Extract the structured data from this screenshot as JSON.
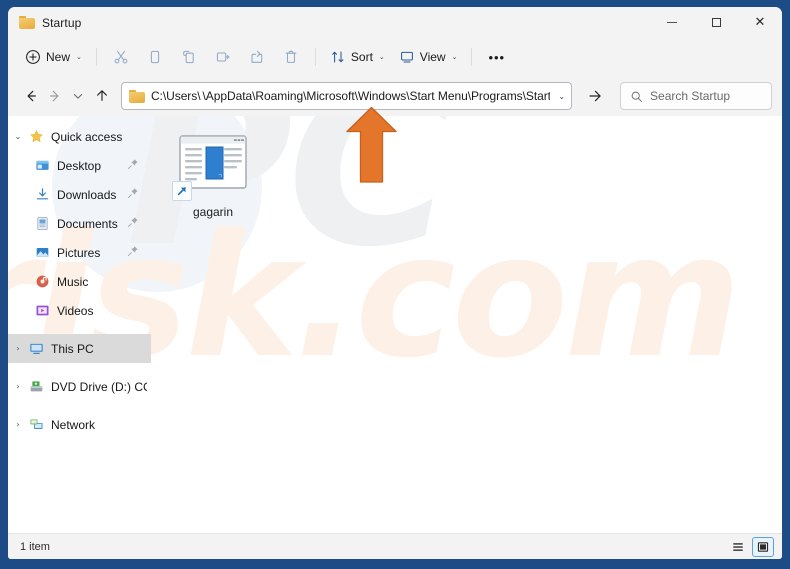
{
  "window": {
    "title": "Startup",
    "title_icon": "folder-icon",
    "controls": {
      "minimize": "–",
      "maximize": "□",
      "close": "×"
    }
  },
  "toolbar": {
    "new_label": "New",
    "new_icon": "plus-circle-icon",
    "cut_icon": "scissors-icon",
    "copy_icon": "copy-icon",
    "paste_icon": "paste-icon",
    "rename_icon": "rename-icon",
    "share_icon": "share-icon",
    "delete_icon": "trash-icon",
    "sort_label": "Sort",
    "sort_icon": "sort-arrows-icon",
    "view_label": "View",
    "view_icon": "monitor-icon",
    "more_label": "•••",
    "chevron": "⌄"
  },
  "navigation": {
    "back_icon": "arrow-left-icon",
    "forward_icon": "arrow-right-icon",
    "recent_icon": "chevron-down-icon",
    "up_icon": "arrow-up-icon",
    "go_icon": "arrow-right-icon"
  },
  "address": {
    "folder_icon": "folder-icon",
    "path_prefix": "C:\\Users\\",
    "path_suffix": "\\AppData\\Roaming\\Microsoft\\Windows\\Start Menu\\Programs\\Startup",
    "redacted_username": "",
    "dropdown_chevron": "⌄"
  },
  "search": {
    "icon": "search-icon",
    "placeholder": "Search Startup",
    "value": ""
  },
  "sidebar": {
    "groups": [
      {
        "label": "Quick access",
        "icon": "star-icon",
        "expander": "⌄",
        "expanded": true,
        "selected": false,
        "items": [
          {
            "label": "Desktop",
            "icon": "desktop-icon",
            "pinned": true,
            "selected": false
          },
          {
            "label": "Downloads",
            "icon": "download-icon",
            "pinned": true,
            "selected": false
          },
          {
            "label": "Documents",
            "icon": "documents-icon",
            "pinned": true,
            "selected": false
          },
          {
            "label": "Pictures",
            "icon": "pictures-icon",
            "pinned": true,
            "selected": false
          },
          {
            "label": "Music",
            "icon": "music-icon",
            "pinned": false,
            "selected": false
          },
          {
            "label": "Videos",
            "icon": "videos-icon",
            "pinned": false,
            "selected": false
          }
        ]
      }
    ],
    "roots": [
      {
        "label": "This PC",
        "icon": "this-pc-icon",
        "expander": "›",
        "selected": true
      },
      {
        "label": "DVD Drive (D:) CCCC",
        "icon": "dvd-drive-icon",
        "expander": "›",
        "selected": false
      },
      {
        "label": "Network",
        "icon": "network-icon",
        "expander": "›",
        "selected": false
      }
    ]
  },
  "content": {
    "files": [
      {
        "name": "gagarin",
        "icon": "application-window-icon",
        "shortcut_overlay": "shortcut-arrow-icon",
        "selected": false
      }
    ]
  },
  "statusbar": {
    "item_count": "1 item",
    "details_view_icon": "details-view-icon",
    "large_icons_view_icon": "large-icons-view-icon",
    "active_view": "large-icons"
  },
  "annotation": {
    "arrow_icon": "orange-pointer-arrow",
    "color": "#e3762a"
  },
  "watermark": {
    "text_primary": "PC",
    "text_secondary": "risk.com",
    "color_primary": "#eef0f2",
    "color_secondary": "#fdf0e6"
  },
  "colors": {
    "window_border": "#1c4b86",
    "chrome_bg": "#f3f3f3",
    "content_bg": "#ffffff",
    "selection_bg": "#dadada",
    "accent_blue": "#0f6cbd"
  }
}
